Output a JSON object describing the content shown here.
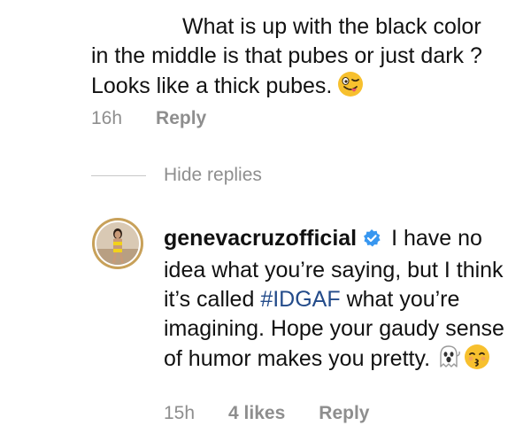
{
  "parent_comment": {
    "text_line1": "What is up with the black color",
    "text_line2": "in the middle is that pubes or just dark ?",
    "text_line3": "Looks like a thick pubes.",
    "emoji": "winking-tongue-face",
    "time": "16h",
    "reply_label": "Reply"
  },
  "hide_replies": {
    "label": "Hide replies"
  },
  "reply": {
    "username": "genevacruzofficial",
    "verified": true,
    "text_before_hashtag": " I have no idea what you’re saying, but I think it’s called ",
    "hashtag": "#IDGAF",
    "text_after_hashtag": " what you’re imagining. Hope your gaudy sense of humor makes you pretty.",
    "emojis": [
      "ghost",
      "kissing-face"
    ],
    "time": "15h",
    "likes": "4 likes",
    "reply_label": "Reply"
  },
  "colors": {
    "text": "#111111",
    "meta": "#8e8e8e",
    "hashtag": "#234b8a",
    "verified_badge": "#3897f0",
    "emoji_yellow": "#f7c02e"
  }
}
